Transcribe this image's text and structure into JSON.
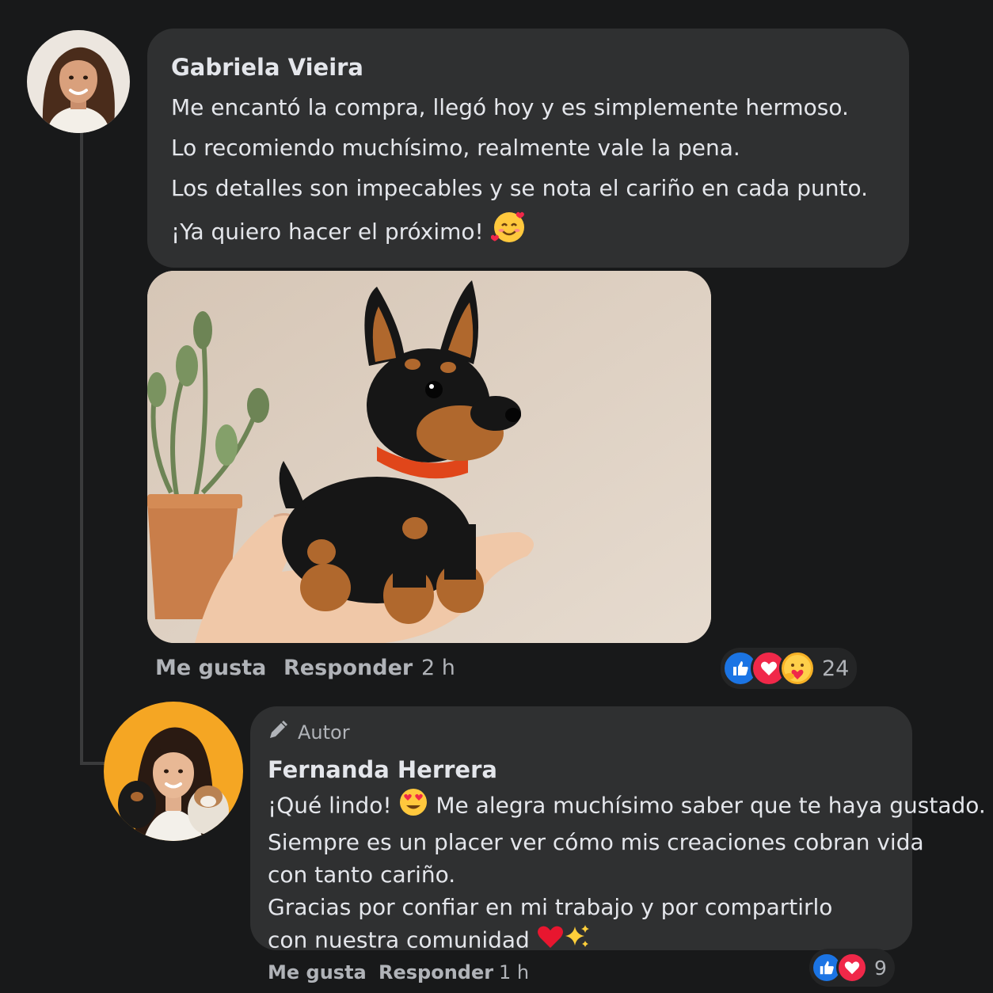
{
  "comment": {
    "author": "Gabriela Vieira",
    "lines": [
      "Me encantó la compra, llegó hoy y es simplemente hermoso.",
      "Lo recomiendo muchísimo, realmente vale la pena.",
      "Los detalles son impecables y se nota el cariño en cada punto.",
      "¡Ya quiero hacer el próximo!"
    ],
    "emoji": "smiling-face-with-hearts",
    "photo": "crochet-doberman-toy-in-hand",
    "actions": {
      "like": "Me gusta",
      "reply": "Responder",
      "time": "2 h"
    },
    "reactions": {
      "icons": [
        "like",
        "love",
        "care"
      ],
      "count": "24"
    }
  },
  "reply": {
    "badge": "Autor",
    "author": "Fernanda Herrera",
    "line1_a": "¡Qué lindo!",
    "line1_b": "Me alegra muchísimo saber que te haya gustado.",
    "lines": [
      "Siempre es un placer ver cómo mis creaciones cobran vida",
      "con tanto cariño.",
      "Gracias por confiar en mi trabajo y por compartirlo"
    ],
    "last_line": "con nuestra comunidad",
    "actions": {
      "like": "Me gusta",
      "reply": "Responder",
      "time": "1 h"
    },
    "reactions": {
      "icons": [
        "like",
        "love"
      ],
      "count": "9"
    }
  },
  "colors": {
    "background": "#18191a",
    "bubble": "#2f3031",
    "like": "#1b74e4",
    "love": "#f02849",
    "muted_text": "#b0b3b8"
  }
}
